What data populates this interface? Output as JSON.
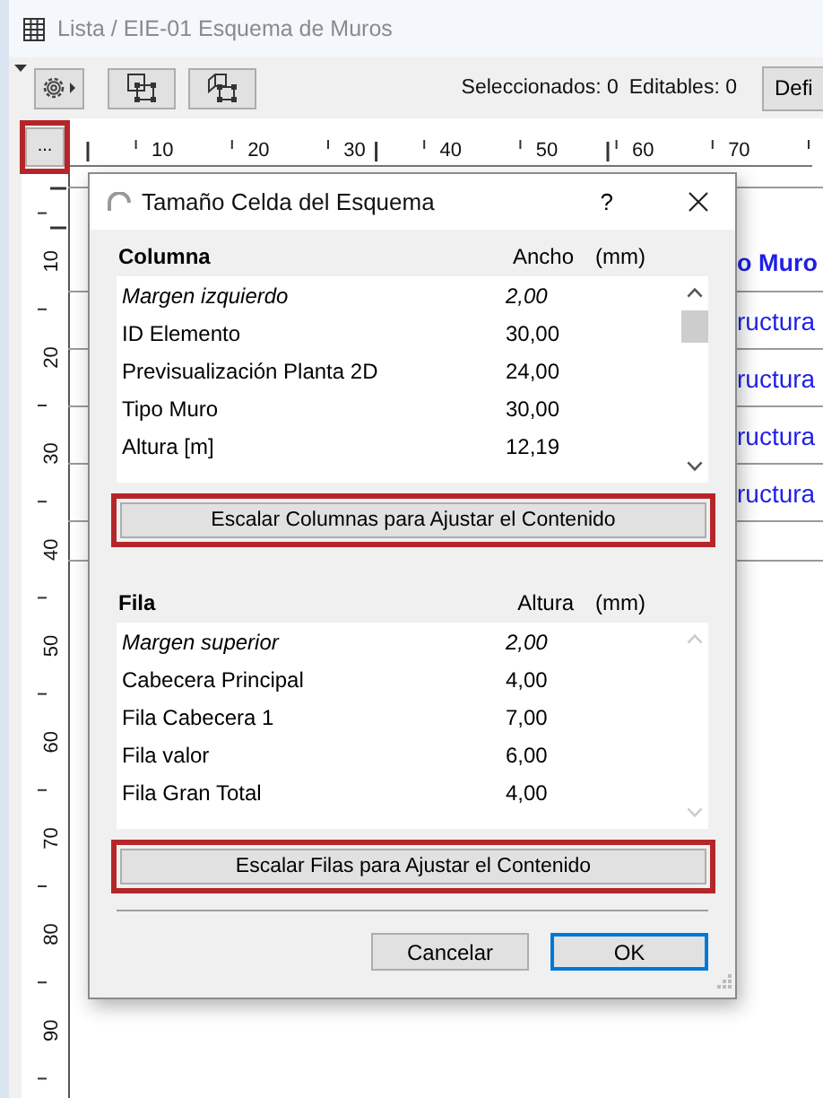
{
  "window": {
    "title": "Lista / EIE-01 Esquema de Muros"
  },
  "toolbar": {
    "selected_count": "Seleccionados: 0",
    "editable_count": "Editables: 0",
    "button": "Defi"
  },
  "ruler": {
    "corner_button": {
      "label": "...",
      "highlighted": true
    },
    "top_numbers": [
      "10",
      "20",
      "30",
      "40",
      "50",
      "60",
      "70"
    ],
    "side_numbers": [
      "10",
      "20",
      "30",
      "40",
      "50",
      "60",
      "70",
      "80",
      "90"
    ]
  },
  "schedule": {
    "header_cell": "o Muro",
    "cells": [
      "ructura",
      "ructura",
      "ructura",
      "ructura"
    ]
  },
  "dialog": {
    "title": "Tamaño Celda del Esquema",
    "help": "?",
    "sections": [
      {
        "heading": "Columna",
        "value_heading": "Ancho",
        "unit": "(mm)",
        "scroll_disabled": false,
        "rows": [
          {
            "kind": "margin",
            "label": "Margen izquierdo",
            "value": "2,00"
          },
          {
            "kind": "item",
            "label": "ID Elemento",
            "value": "30,00"
          },
          {
            "kind": "item",
            "label": "Previsualización Planta 2D",
            "value": "24,00"
          },
          {
            "kind": "item",
            "label": "Tipo Muro",
            "value": "30,00"
          },
          {
            "kind": "item",
            "label": "Altura [m]",
            "value": "12,19"
          }
        ],
        "button": {
          "label": "Escalar Columnas para Ajustar el Contenido",
          "highlighted": true
        }
      },
      {
        "heading": "Fila",
        "value_heading": "Altura",
        "unit": "(mm)",
        "scroll_disabled": true,
        "rows": [
          {
            "kind": "margin",
            "label": "Margen superior",
            "value": "2,00"
          },
          {
            "kind": "item",
            "label": "Cabecera Principal",
            "value": "4,00"
          },
          {
            "kind": "item",
            "label": "Fila Cabecera 1",
            "value": "7,00"
          },
          {
            "kind": "item",
            "label": "Fila valor",
            "value": "6,00"
          },
          {
            "kind": "item",
            "label": "Fila Gran Total",
            "value": "4,00"
          }
        ],
        "button": {
          "label": "Escalar Filas para Ajustar el Contenido",
          "highlighted": true
        }
      }
    ],
    "buttons": [
      {
        "label": "Cancelar",
        "default": false
      },
      {
        "label": "OK",
        "default": true
      }
    ]
  }
}
